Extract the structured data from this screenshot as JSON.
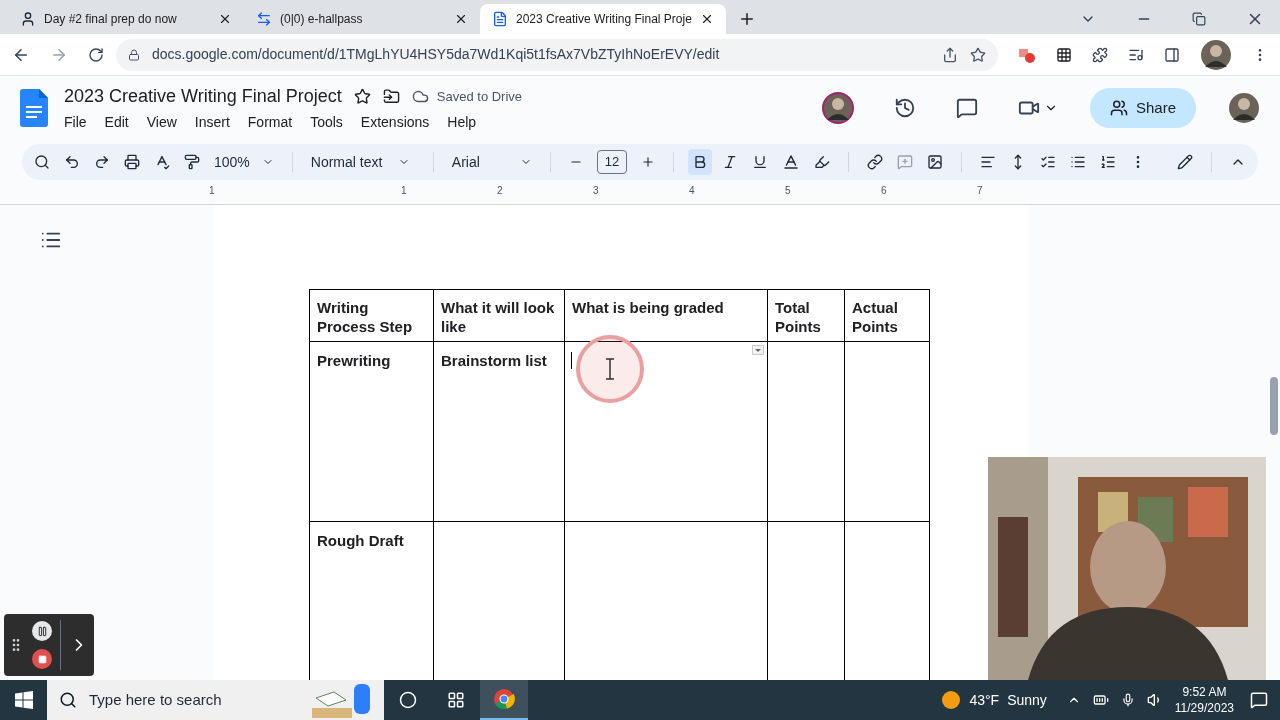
{
  "browser": {
    "tabs": [
      {
        "title": "Day #2 final prep do now",
        "kind": "classroom",
        "selected": false
      },
      {
        "title": "(0|0) e-hallpass",
        "kind": "hallpass",
        "selected": false
      },
      {
        "title": "2023 Creative Writing Final Proje",
        "kind": "docs",
        "selected": true
      }
    ],
    "url": "docs.google.com/document/d/1TMgLhYU4HSY5da7Wd1Kqi5t1fsAx7VbZTyIhNoErEVY/edit"
  },
  "document": {
    "title": "2023 Creative Writing Final Project",
    "save_status": "Saved to Drive",
    "menus": [
      "File",
      "Edit",
      "View",
      "Insert",
      "Format",
      "Tools",
      "Extensions",
      "Help"
    ],
    "share_label": "Share"
  },
  "toolbar": {
    "zoom": "100%",
    "style": "Normal text",
    "font": "Arial",
    "size": "12",
    "formats": [
      {
        "kind": "bold",
        "on": true
      },
      {
        "kind": "italic",
        "on": false
      },
      {
        "kind": "underline",
        "on": false
      }
    ]
  },
  "ruler": [
    "1",
    "1",
    "2",
    "3",
    "4",
    "5",
    "6",
    "7"
  ],
  "table": {
    "columns": [
      "Writing Process Step",
      "What it will look like",
      "What is being graded",
      "Total Points",
      "Actual Points"
    ],
    "rows": [
      [
        "Prewriting",
        "Brainstorm list",
        "",
        "",
        ""
      ],
      [
        "Rough Draft",
        "",
        "",
        "",
        ""
      ]
    ]
  },
  "taskbar": {
    "search_placeholder": "Type here to search",
    "apps": [
      {
        "kind": "cortana",
        "selected": false
      },
      {
        "kind": "taskview",
        "selected": false
      },
      {
        "kind": "chrome",
        "selected": true
      }
    ],
    "temperature": "43°F",
    "weather": "Sunny",
    "time": "9:52 AM",
    "date": "11/29/2023"
  }
}
